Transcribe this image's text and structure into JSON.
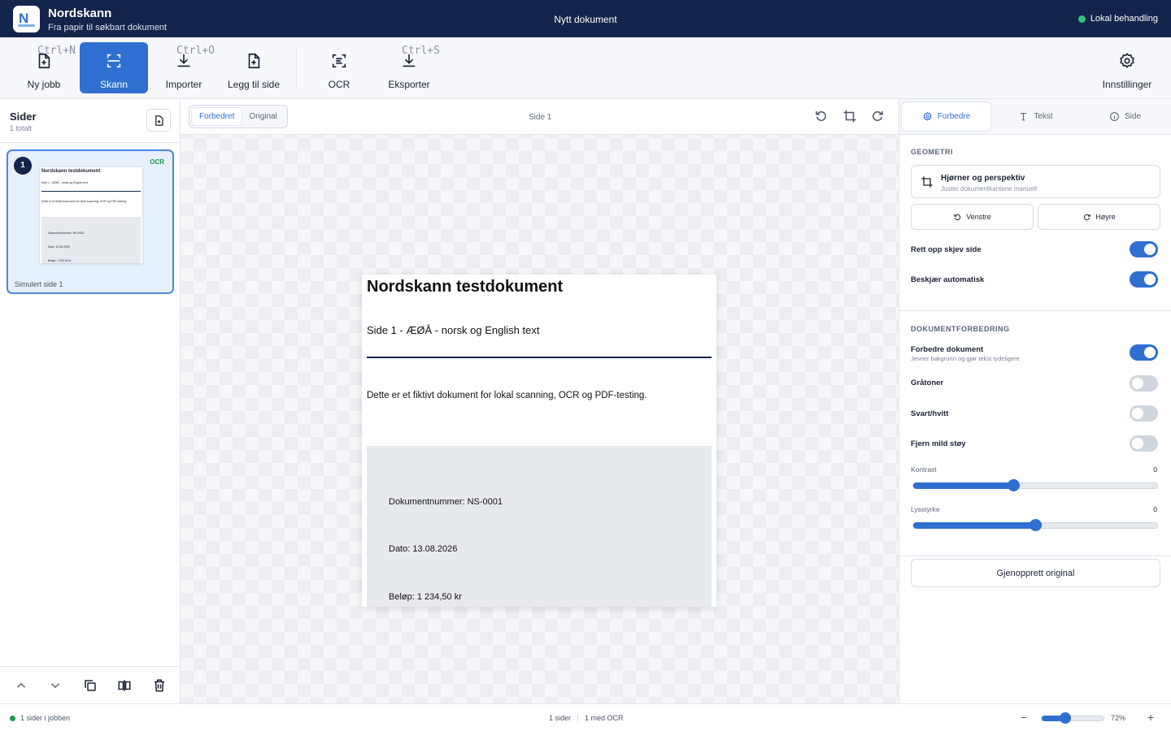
{
  "app": {
    "name": "Nordskann",
    "subtitle": "Fra papir til søkbart dokument",
    "document_title": "Nytt dokument",
    "status": "Lokal behandling"
  },
  "toolbar": {
    "new_job": "Ny jobb",
    "new_job_shortcut": "Ctrl+N",
    "scan": "Skann",
    "import": "Importer",
    "import_shortcut": "Ctrl+O",
    "add_page": "Legg til side",
    "ocr": "OCR",
    "export": "Eksporter",
    "export_shortcut": "Ctrl+S",
    "settings": "Innstillinger"
  },
  "sidebar": {
    "title": "Sider",
    "count": "1 totalt",
    "page": {
      "number": "1",
      "badge": "OCR",
      "label": "Simulert side 1"
    }
  },
  "canvas": {
    "view_enhanced": "Forbedret",
    "view_original": "Original",
    "page_indicator": "Side 1"
  },
  "document": {
    "title": "Nordskann testdokument",
    "subtitle": "Side 1 - ÆØÅ - norsk og English text",
    "body": "Dette er et fiktivt dokument for lokal scanning, OCR og PDF-testing.",
    "fields": [
      "Dokumentnummer: NS-0001",
      "Dato: 13.08.2026",
      "Beløp: 1 234,50 kr"
    ]
  },
  "panel": {
    "tabs": [
      "Forbedre",
      "Tekst",
      "Side"
    ],
    "geometry": {
      "title": "GEOMETRI",
      "corners_title": "Hjørner og perspektiv",
      "corners_sub": "Juster dokumentkantene manuelt",
      "rotate_left": "Venstre",
      "rotate_right": "Høyre",
      "deskew": "Rett opp skjev side",
      "deskew_on": true,
      "autocrop": "Beskjær automatisk",
      "autocrop_on": true
    },
    "enhance": {
      "title": "DOKUMENTFORBEDRING",
      "enhance_doc": "Forbedre dokument",
      "enhance_doc_sub": "Jevner bakgrunn og gjør tekst tydeligere",
      "enhance_doc_on": true,
      "grayscale": "Gråtoner",
      "grayscale_on": false,
      "bw": "Svart/hvitt",
      "bw_on": false,
      "denoise": "Fjern mild støy",
      "denoise_on": false,
      "contrast_label": "Kontrast",
      "contrast_value": "0",
      "contrast_fraction": 0.41,
      "brightness_label": "Lysstyrke",
      "brightness_value": "0",
      "brightness_fraction": 0.5
    },
    "restore": "Gjenopprett original"
  },
  "statusbar": {
    "pages_in_job": "1 sider i jobben",
    "pages": "1 sider",
    "with_ocr": "1 med OCR",
    "zoom": "72%",
    "zoom_fraction": 0.38
  },
  "colors": {
    "titlebar": "#13254a",
    "accent": "#2f6fd1",
    "ok": "#35c27a"
  }
}
